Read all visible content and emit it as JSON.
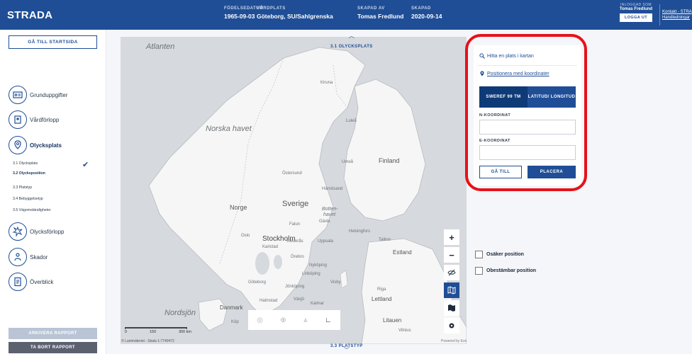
{
  "header": {
    "brand": "STRADA",
    "fields": [
      {
        "label": "FÖDELSEDATUM",
        "value": "1965-09-03"
      },
      {
        "label": "VÅRDPLATS",
        "value": "Göteborg, SU/Sahlgrenska"
      },
      {
        "label": "SKAPAD AV",
        "value": "Tomas Fredlund"
      },
      {
        "label": "SKAPAD",
        "value": "2020-09-14"
      }
    ],
    "login": {
      "label": "INLOGGAD SOM",
      "name": "Tomas Fredlund",
      "logout": "LOGGA UT"
    },
    "links": [
      "Kontakt - STRA",
      "Handledningar"
    ]
  },
  "sidebar": {
    "home_button": "GÅ TILL STARTSIDA",
    "nav": [
      {
        "label": "Grunduppgifter",
        "icon": "id-card-icon"
      },
      {
        "label": "Vårdförlopp",
        "icon": "hospital-icon"
      },
      {
        "label": "Olycksplats",
        "icon": "location-icon"
      },
      {
        "label": "Olycksförlopp",
        "icon": "collision-icon"
      },
      {
        "label": "Skador",
        "icon": "injury-icon"
      },
      {
        "label": "Överblick",
        "icon": "document-icon"
      }
    ],
    "subitems": [
      "3.1 Olycksplats",
      "3.2 Olycksposition",
      "3.3 Platstyp",
      "3.4 Bebyggelsetyp",
      "3.5 Vägomständigheter"
    ],
    "archive_button": "ARKIVERA RAPPORT",
    "delete_button": "TA BORT RAPPORT"
  },
  "main": {
    "prev_section": "3.1 OLYCKSPLATS",
    "next_section": "3.3 PLATSTYP"
  },
  "map": {
    "labels": {
      "atlanten": "Atlanten",
      "norska_havet": "Norska havet",
      "nordsjon": "Nordsjön",
      "sverige": "Sverige",
      "norge": "Norge",
      "finland": "Finland",
      "estland": "Estland",
      "lettland": "Lettland",
      "litauen": "Litauen",
      "danmark": "Danmark",
      "botten": "Botten-",
      "havet": "havet",
      "kiruna": "Kiruna",
      "lulea": "Luleå",
      "umea": "Umeå",
      "ostersund": "Östersund",
      "harnosand": "Härnösand",
      "falun": "Falun",
      "gavle": "Gävle",
      "uppsala": "Uppsala",
      "vasteras": "Västerås",
      "karlstad": "Karlstad",
      "orebro": "Örebro",
      "stockholm": "Stockholm",
      "nykoping": "Nyköping",
      "linkoping": "Linköping",
      "goteborg": "Göteborg",
      "jonkoping": "Jönköping",
      "visby": "Visby",
      "vaxjo": "Växjö",
      "halmstad": "Halmstad",
      "kalmar": "Kalmar",
      "helsingfors": "Helsingfors",
      "tallinn": "Tallinn",
      "oslo": "Oslo",
      "riga": "Riga",
      "vilnius": "Vilnius",
      "kob": "Köp"
    },
    "scale_numbers": [
      "0",
      "150",
      "300 km"
    ],
    "attribution": "© Lantmäteriet - Skala 1:7740472",
    "powered_by": "Powered by Esri",
    "controls": [
      "zoom-in",
      "zoom-out",
      "hide-layer",
      "map-layer",
      "basemap",
      "settings"
    ],
    "toolbar": [
      "target-icon",
      "zoom-search-icon",
      "road-icon",
      "measure-icon"
    ]
  },
  "coord_panel": {
    "find_link": "Hitta en plats i kartan",
    "position_link": "Positionera med koordinater",
    "tab_sweref": "SWEREF 99 TM",
    "tab_latlong": "LATITUD/ LONGITUD",
    "n_label": "N-KOORDINAT",
    "e_label": "E-KOORDINAT",
    "n_value": "",
    "e_value": "",
    "goto_button": "GÅ TILL",
    "place_button": "PLACERA"
  },
  "checkboxes": [
    {
      "label": "Osäker position",
      "checked": false
    },
    {
      "label": "Obestämbar position",
      "checked": false
    }
  ],
  "colors": {
    "primary": "#1f4e96",
    "highlight": "#e8101a"
  }
}
